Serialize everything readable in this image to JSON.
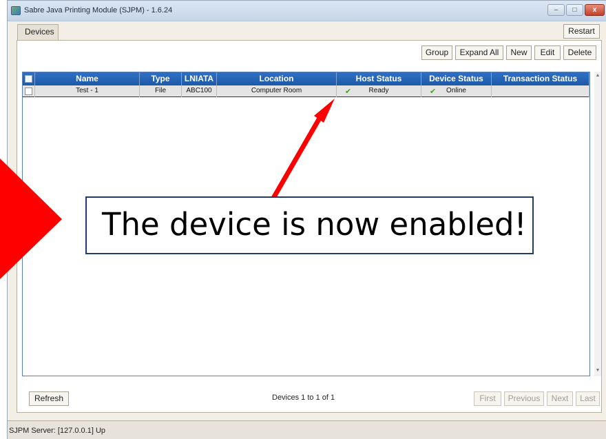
{
  "window": {
    "title": "Sabre Java Printing Module (SJPM) - 1.6.24",
    "controls": {
      "minimize": "–",
      "maximize": "□",
      "close": "x"
    }
  },
  "tabs": {
    "devices": "Devices",
    "restart": "Restart"
  },
  "toolbar": {
    "group": "Group",
    "expand_all": "Expand All",
    "new": "New",
    "edit": "Edit",
    "delete": "Delete"
  },
  "table": {
    "columns": [
      "Name",
      "Type",
      "LNIATA",
      "Location",
      "Host Status",
      "Device Status",
      "Transaction Status"
    ],
    "rows": [
      {
        "name": "Test - 1",
        "type": "File",
        "lniata": "ABC100",
        "location": "Computer Room",
        "host_status": "Ready",
        "device_status": "Online",
        "transaction_status": ""
      }
    ]
  },
  "footer": {
    "refresh": "Refresh",
    "pager_text": "Devices 1 to 1 of 1",
    "first": "First",
    "previous": "Previous",
    "next": "Next",
    "last": "Last"
  },
  "status_bar": {
    "text": "SJPM Server: [127.0.0.1] Up"
  },
  "annotation": {
    "text": "The device is now enabled!"
  },
  "colors": {
    "header_blue": "#1d5aa8",
    "check_green": "#46a11f",
    "arrow_red": "#ff0000"
  },
  "icons": {
    "row_status": "checkmark-icon"
  }
}
